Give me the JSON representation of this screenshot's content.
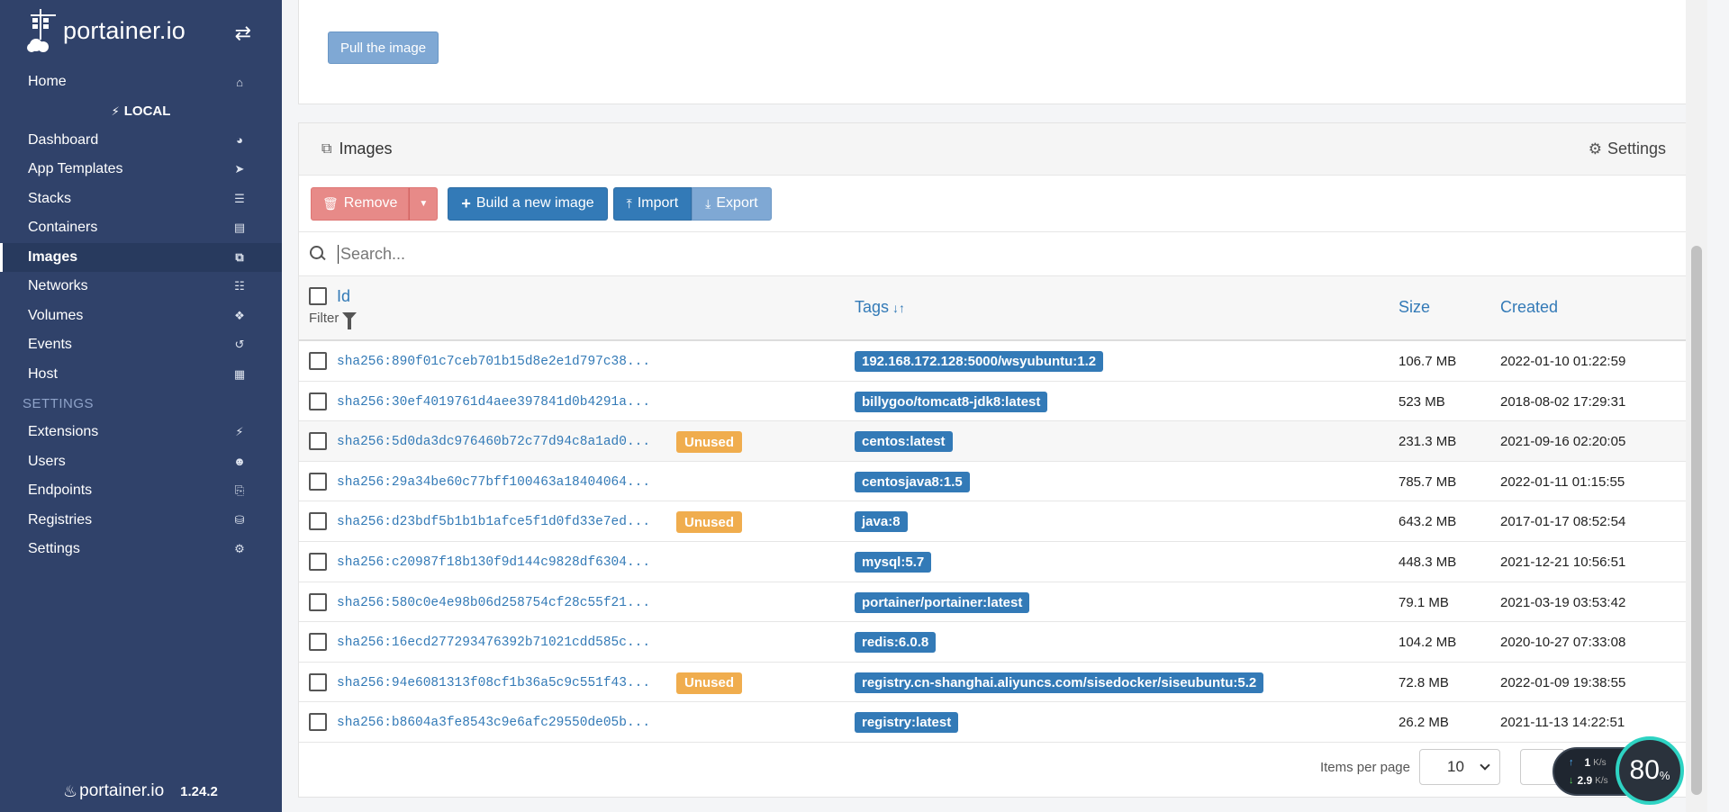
{
  "brand": {
    "name": "portainer.io",
    "toggle_icon": "exchange-icon"
  },
  "sidebar": {
    "items_top": [
      {
        "label": "Home",
        "icon": "home-icon"
      }
    ],
    "endpoint": "LOCAL",
    "items_endpoint": [
      {
        "label": "Dashboard",
        "icon": "dashboard-icon"
      },
      {
        "label": "App Templates",
        "icon": "rocket-icon"
      },
      {
        "label": "Stacks",
        "icon": "list-icon"
      },
      {
        "label": "Containers",
        "icon": "server-icon"
      },
      {
        "label": "Images",
        "icon": "clone-icon",
        "active": true
      },
      {
        "label": "Networks",
        "icon": "sitemap-icon"
      },
      {
        "label": "Volumes",
        "icon": "cubes-icon"
      },
      {
        "label": "Events",
        "icon": "history-icon"
      },
      {
        "label": "Host",
        "icon": "th-icon"
      }
    ],
    "section_label": "SETTINGS",
    "items_settings": [
      {
        "label": "Extensions",
        "icon": "bolt-icon"
      },
      {
        "label": "Users",
        "icon": "users-icon"
      },
      {
        "label": "Endpoints",
        "icon": "plug-icon"
      },
      {
        "label": "Registries",
        "icon": "database-icon"
      },
      {
        "label": "Settings",
        "icon": "cogs-icon"
      }
    ],
    "footer": {
      "logo": "portainer.io",
      "version": "1.24.2"
    }
  },
  "pull_panel": {
    "pull_button": "Pull the image"
  },
  "images_panel": {
    "title": "Images",
    "settings_label": "Settings",
    "actions": {
      "remove": "Remove",
      "build": "Build a new image",
      "import": "Import",
      "export": "Export"
    },
    "search": {
      "placeholder": "Search...",
      "value": ""
    },
    "columns": {
      "id": "Id",
      "filter": "Filter",
      "tags": "Tags",
      "size": "Size",
      "created": "Created"
    },
    "rows": [
      {
        "id": "sha256:890f01c7ceb701b15d8e2e1d797c38...",
        "unused": false,
        "tag": "192.168.172.128:5000/wsyubuntu:1.2",
        "size": "106.7 MB",
        "created": "2022-01-10 01:22:59"
      },
      {
        "id": "sha256:30ef4019761d4aee397841d0b4291a...",
        "unused": false,
        "tag": "billygoo/tomcat8-jdk8:latest",
        "size": "523 MB",
        "created": "2018-08-02 17:29:31"
      },
      {
        "id": "sha256:5d0da3dc976460b72c77d94c8a1ad0...",
        "unused": true,
        "tag": "centos:latest",
        "size": "231.3 MB",
        "created": "2021-09-16 02:20:05"
      },
      {
        "id": "sha256:29a34be60c77bff100463a18404064...",
        "unused": false,
        "tag": "centosjava8:1.5",
        "size": "785.7 MB",
        "created": "2022-01-11 01:15:55"
      },
      {
        "id": "sha256:d23bdf5b1b1b1afce5f1d0fd33e7ed...",
        "unused": true,
        "tag": "java:8",
        "size": "643.2 MB",
        "created": "2017-01-17 08:52:54"
      },
      {
        "id": "sha256:c20987f18b130f9d144c9828df6304...",
        "unused": false,
        "tag": "mysql:5.7",
        "size": "448.3 MB",
        "created": "2021-12-21 10:56:51"
      },
      {
        "id": "sha256:580c0e4e98b06d258754cf28c55f21...",
        "unused": false,
        "tag": "portainer/portainer:latest",
        "size": "79.1 MB",
        "created": "2021-03-19 03:53:42"
      },
      {
        "id": "sha256:16ecd277293476392b71021cdd585c...",
        "unused": false,
        "tag": "redis:6.0.8",
        "size": "104.2 MB",
        "created": "2020-10-27 07:33:08"
      },
      {
        "id": "sha256:94e6081313f08cf1b36a5c9c551f43...",
        "unused": true,
        "tag": "registry.cn-shanghai.aliyuncs.com/sisedocker/siseubuntu:5.2",
        "size": "72.8 MB",
        "created": "2022-01-09 19:38:55"
      },
      {
        "id": "sha256:b8604a3fe8543c9e6afc29550de05b...",
        "unused": false,
        "tag": "registry:latest",
        "size": "26.2 MB",
        "created": "2021-11-13 14:22:51"
      }
    ],
    "unused_label": "Unused",
    "pagination": {
      "items_per_page_label": "Items per page",
      "items_per_page": "10"
    }
  },
  "net_monitor": {
    "up": "1",
    "up_unit": "K/s",
    "down": "2.9",
    "down_unit": "K/s",
    "percent": "80",
    "percent_sign": "%"
  },
  "colors": {
    "sidebar": "#30426a",
    "primary": "#337ab7",
    "danger": "#e78a88",
    "warning": "#f0ad4e"
  }
}
